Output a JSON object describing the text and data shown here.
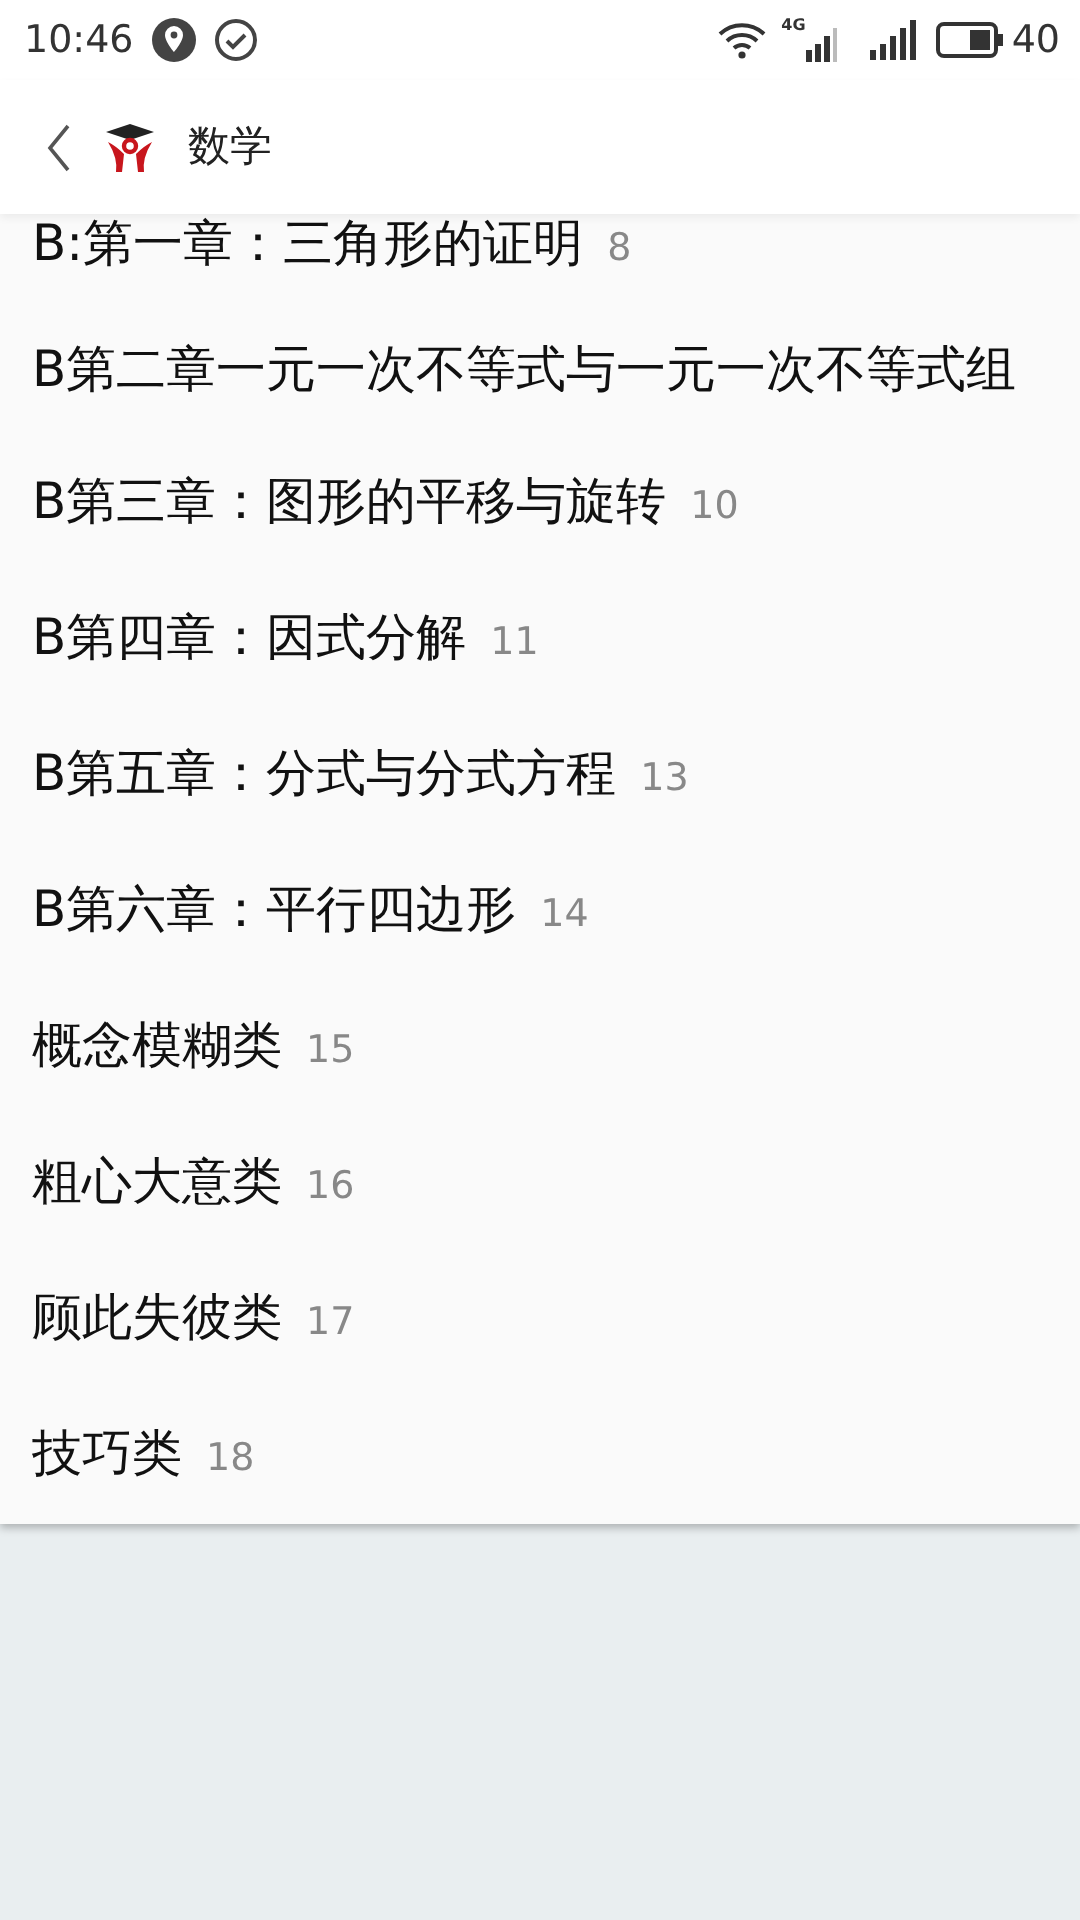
{
  "status_bar": {
    "time": "10:46",
    "network_label": "4G",
    "battery": "40"
  },
  "header": {
    "title": "数学"
  },
  "items": [
    {
      "title": "B:第一章：三角形的证明",
      "count": "8"
    },
    {
      "title": "B第二章一元一次不等式与一元一次不等式组"
    },
    {
      "title": "B第三章：图形的平移与旋转",
      "count": "10"
    },
    {
      "title": "B第四章：因式分解",
      "count": "11"
    },
    {
      "title": "B第五章：分式与分式方程",
      "count": "13"
    },
    {
      "title": "B第六章：平行四边形",
      "count": "14"
    },
    {
      "title": "概念模糊类",
      "count": "15"
    },
    {
      "title": "粗心大意类",
      "count": "16"
    },
    {
      "title": "顾此失彼类",
      "count": "17"
    },
    {
      "title": "技巧类",
      "count": "18"
    }
  ]
}
